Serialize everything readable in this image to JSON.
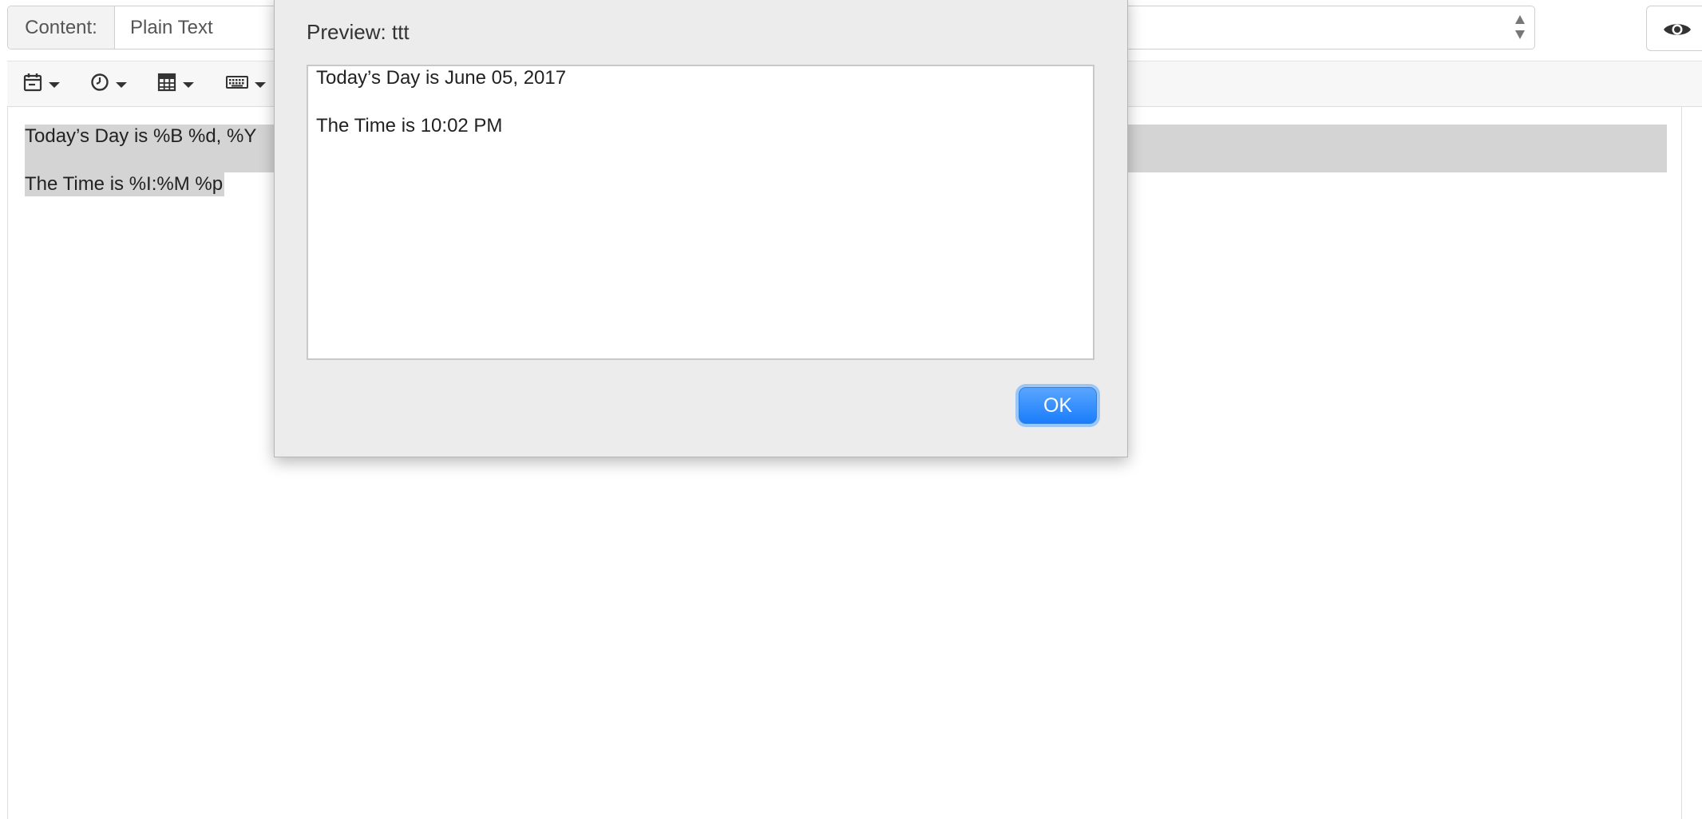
{
  "content_bar": {
    "label": "Content:",
    "selected": "Plain Text"
  },
  "toolbar": {
    "items": [
      {
        "icon": "calendar-icon"
      },
      {
        "icon": "clock-icon"
      },
      {
        "icon": "calculator-icon"
      },
      {
        "icon": "keyboard-icon"
      }
    ]
  },
  "editor": {
    "lines": [
      "Today’s Day is %B %d, %Y",
      "The Time is %I:%M %p"
    ]
  },
  "modal": {
    "title": "Preview: ttt",
    "preview_lines": [
      "Today’s Day is June 05, 2017",
      "The Time is 10:02 PM"
    ],
    "ok_label": "OK"
  },
  "colors": {
    "accent": "#1a7dfb",
    "selection": "#d4d4d4",
    "dialog_bg": "#ececec"
  }
}
